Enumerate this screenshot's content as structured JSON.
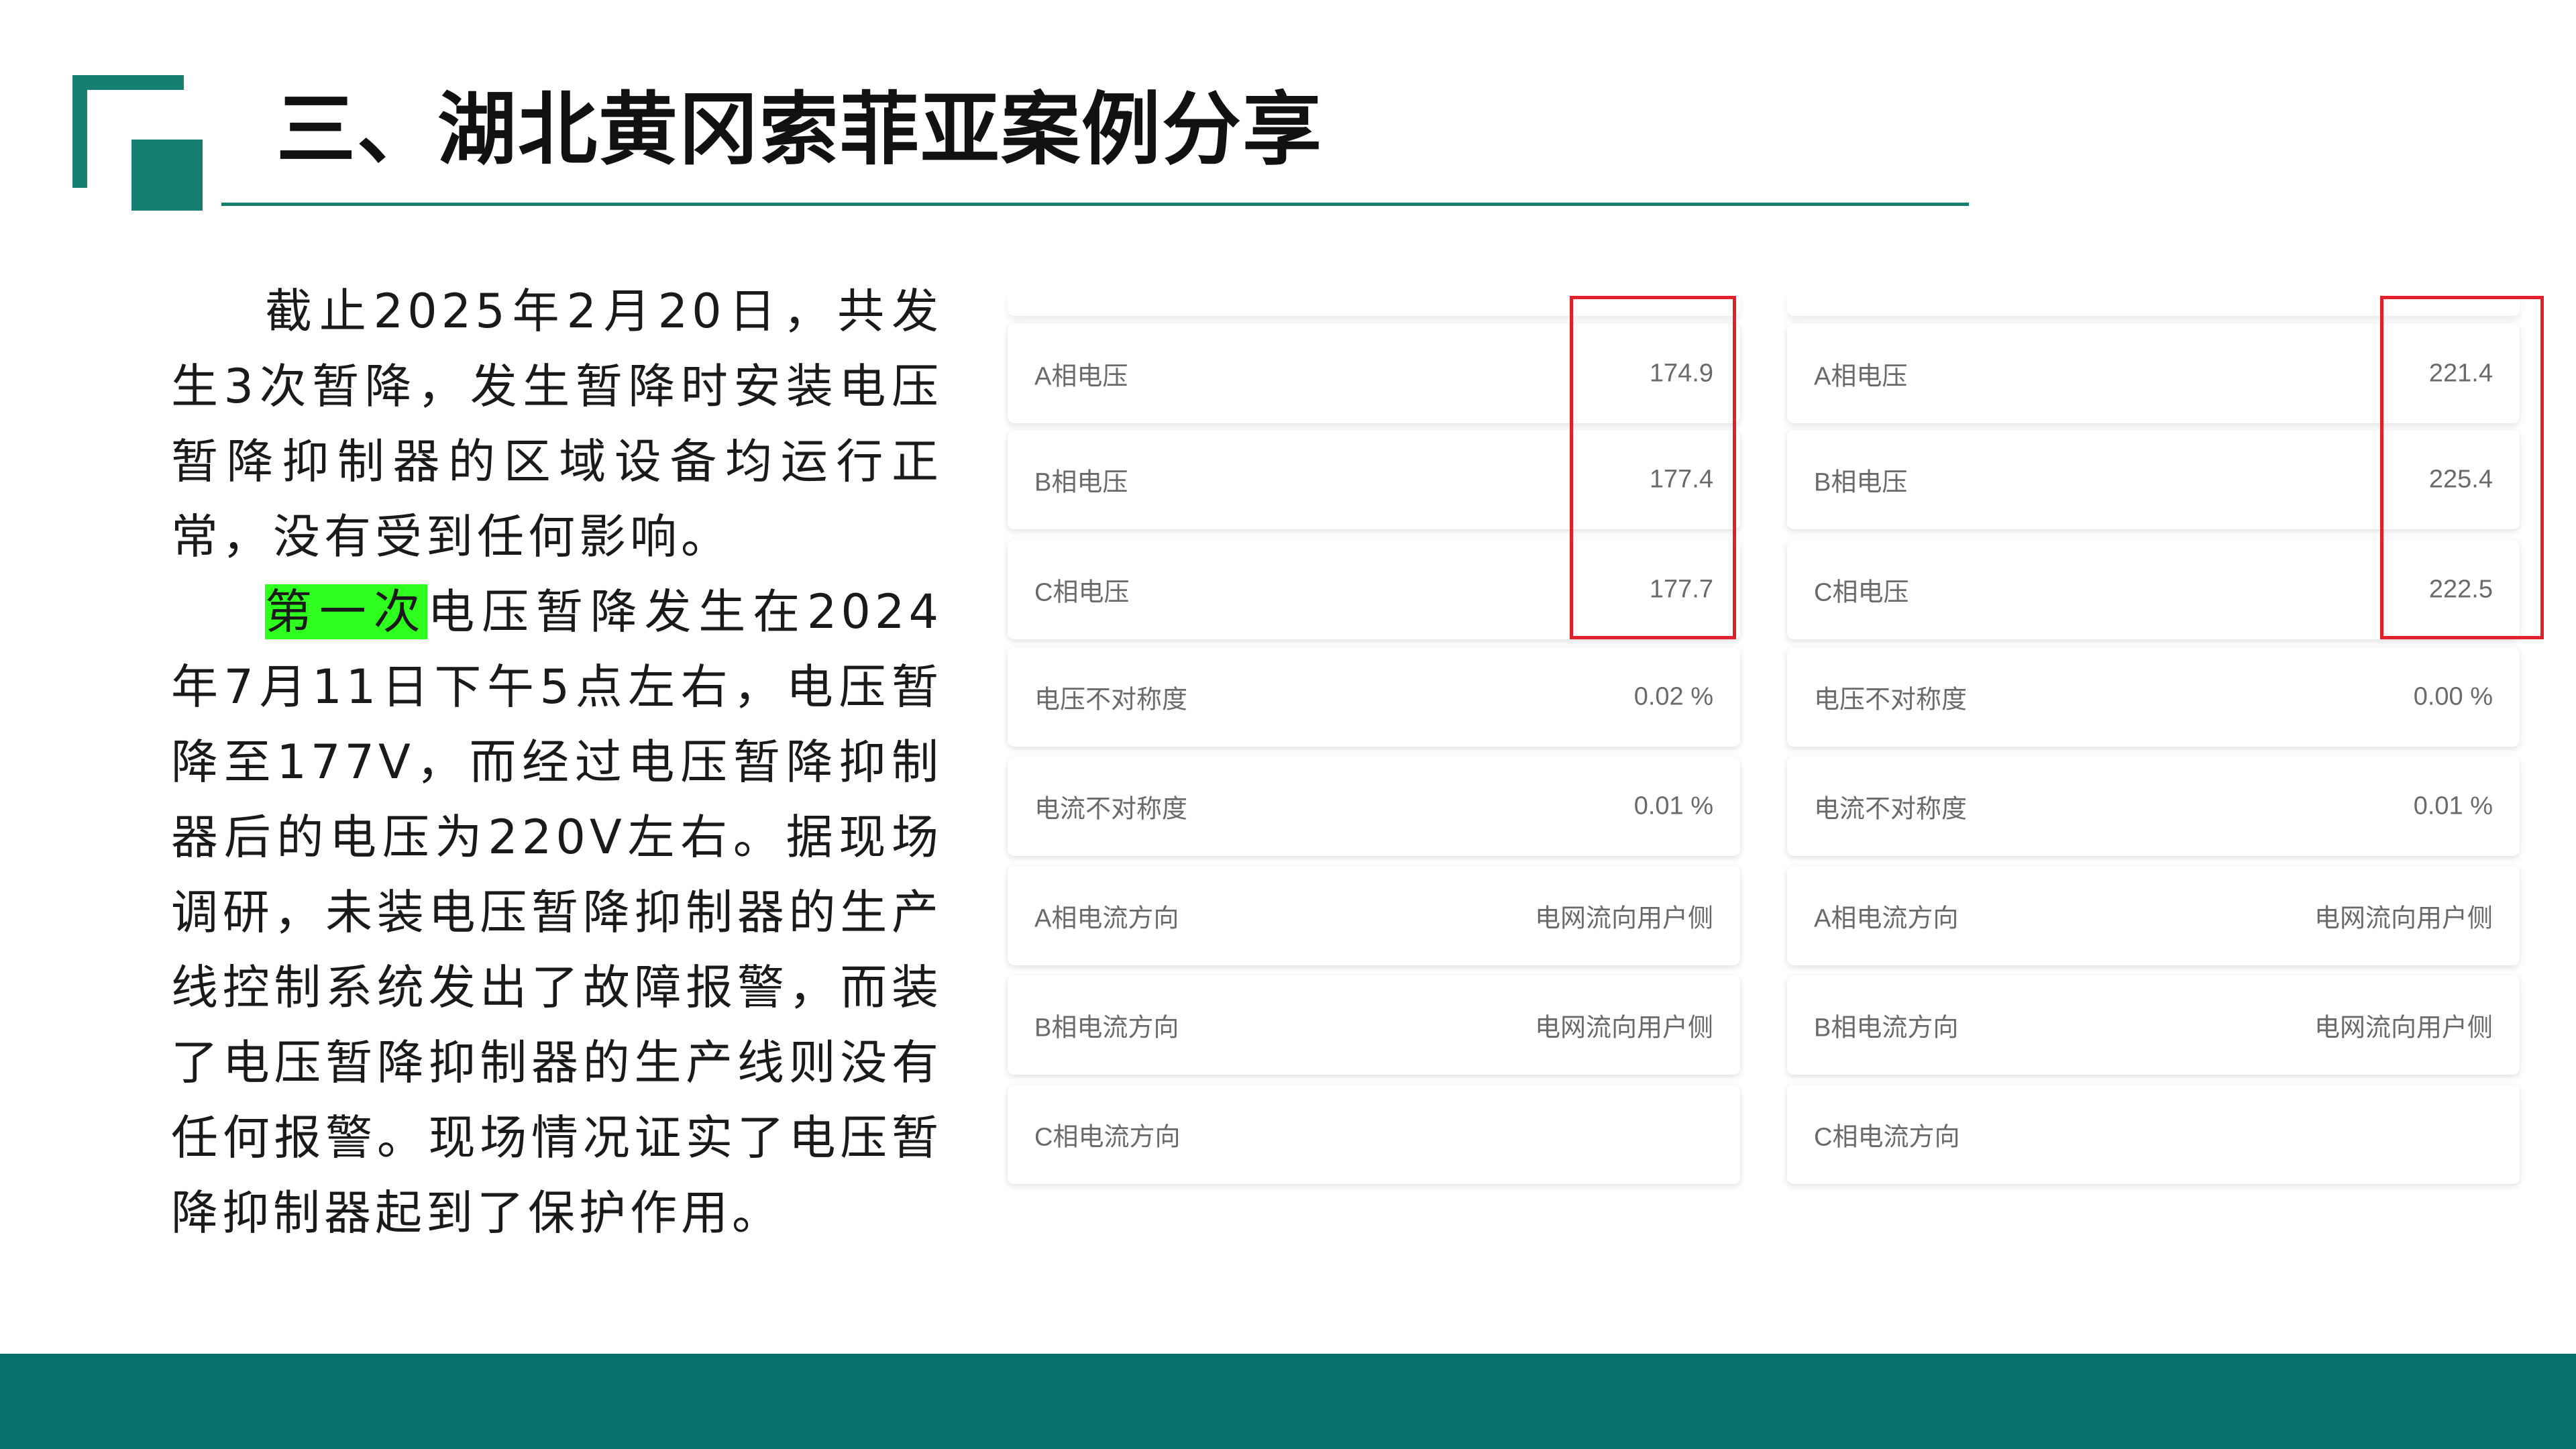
{
  "title": "三、湖北黄冈索菲亚案例分享",
  "body": {
    "paragraph1": "截止2025年2月20日，共发生3次暂降，发生暂降时安装电压暂降抑制器的区域设备均运行正常，没有受到任何影响。",
    "paragraph2_highlight": "第一次",
    "paragraph2_rest": "电压暂降发生在2024年7月11日下午5点左右，电压暂降至177V，而经过电压暂降抑制器后的电压为220V左右。据现场调研，未装电压暂降抑制器的生产线控制系统发出了故障报警，而装了电压暂降抑制器的生产线则没有任何报警。现场情况证实了电压暂降抑制器起到了保护作用。"
  },
  "panels": [
    {
      "rows": [
        {
          "label": "A相电压",
          "value": "174.9"
        },
        {
          "label": "B相电压",
          "value": "177.4"
        },
        {
          "label": "C相电压",
          "value": "177.7"
        },
        {
          "label": "电压不对称度",
          "value": "0.02 %"
        },
        {
          "label": "电流不对称度",
          "value": "0.01 %"
        },
        {
          "label": "A相电流方向",
          "value": "电网流向用户侧"
        },
        {
          "label": "B相电流方向",
          "value": "电网流向用户侧"
        },
        {
          "label": "C相电流方向",
          "value": ""
        }
      ]
    },
    {
      "rows": [
        {
          "label": "A相电压",
          "value": "221.4"
        },
        {
          "label": "B相电压",
          "value": "225.4"
        },
        {
          "label": "C相电压",
          "value": "222.5"
        },
        {
          "label": "电压不对称度",
          "value": "0.00 %"
        },
        {
          "label": "电流不对称度",
          "value": "0.01 %"
        },
        {
          "label": "A相电流方向",
          "value": "电网流向用户侧"
        },
        {
          "label": "B相电流方向",
          "value": "电网流向用户侧"
        },
        {
          "label": "C相电流方向",
          "value": ""
        }
      ]
    }
  ],
  "colors": {
    "brand_green": "#06706a",
    "highlight": "#2eff1f",
    "red_box": "#e0202a"
  }
}
